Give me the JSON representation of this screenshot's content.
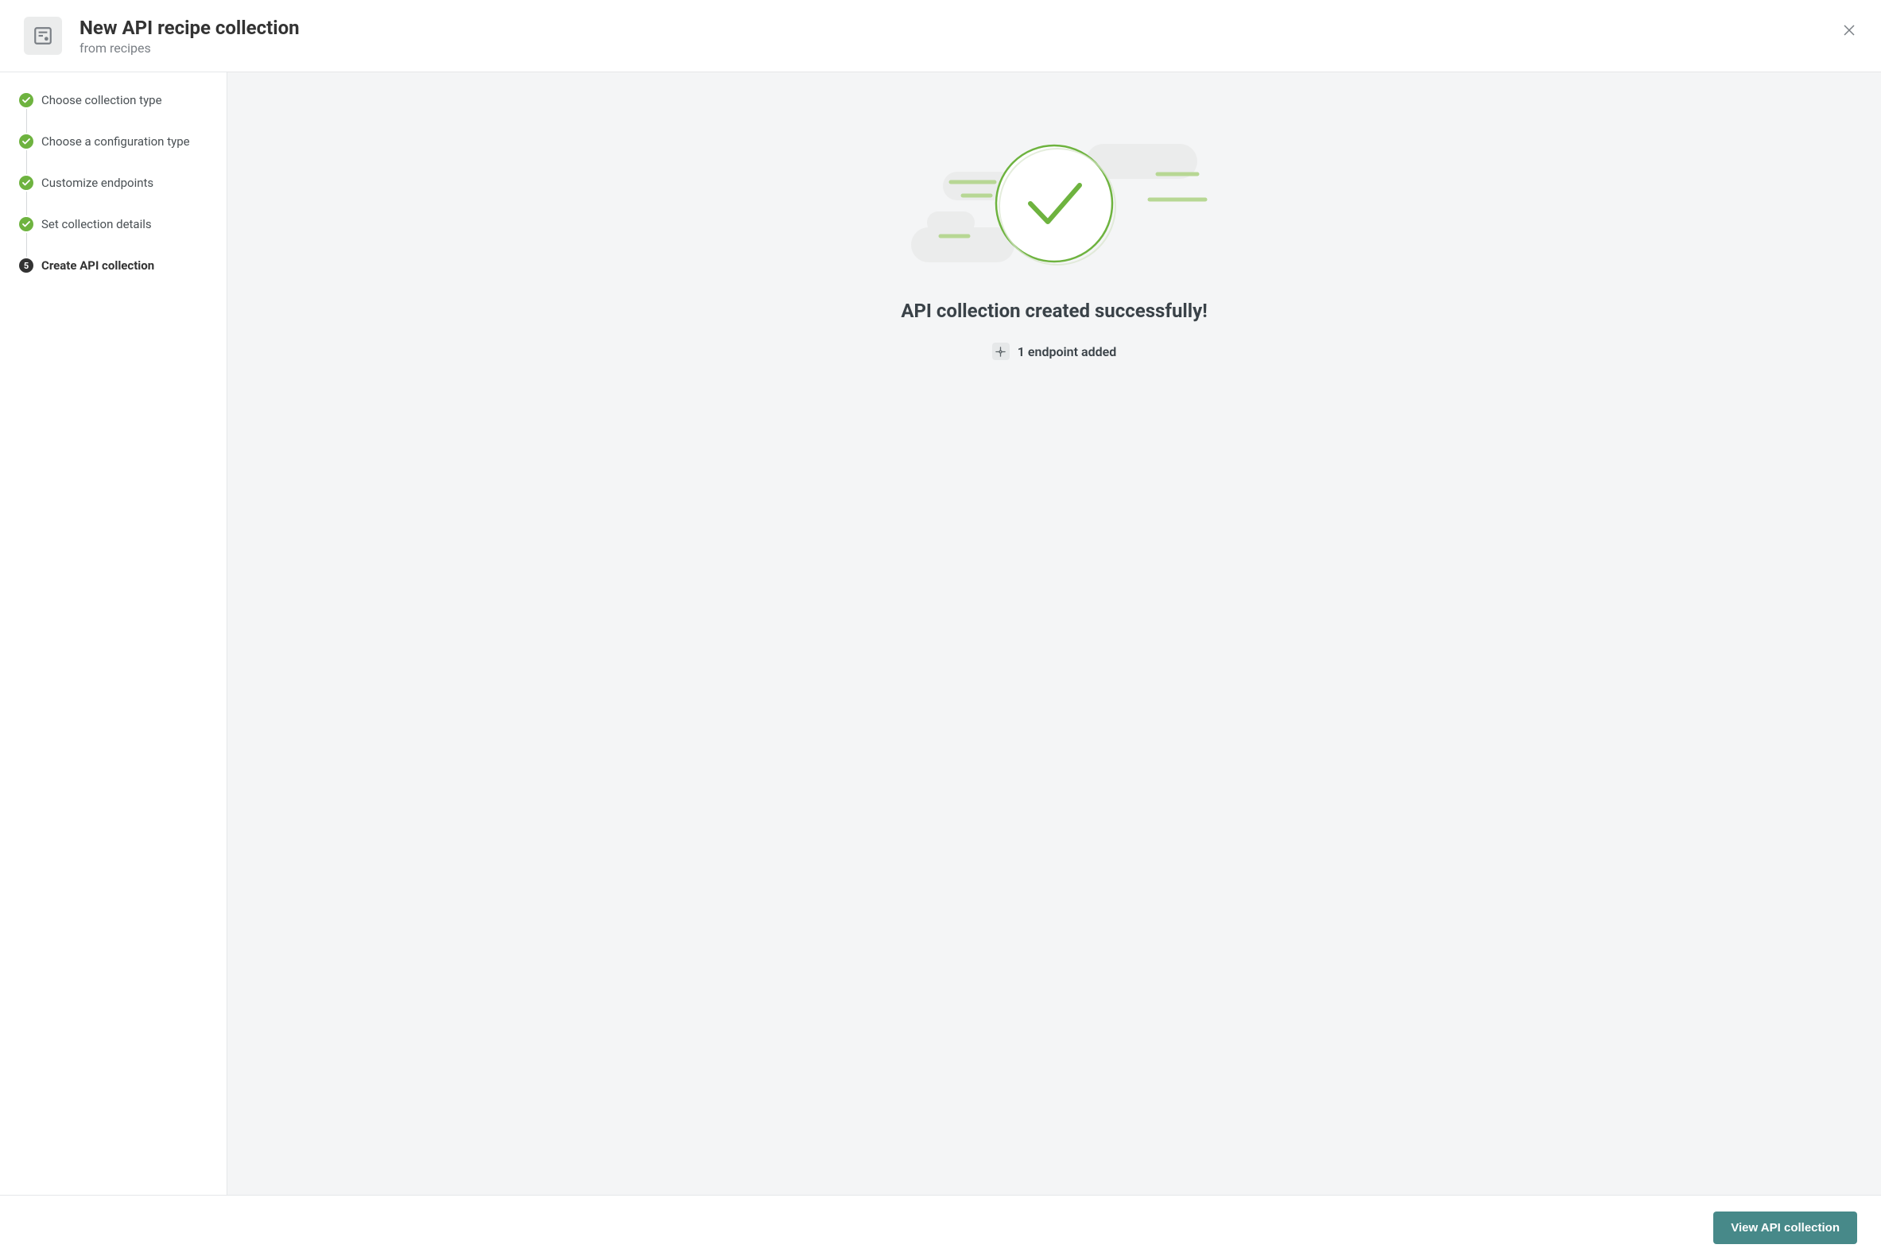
{
  "header": {
    "title": "New API recipe collection",
    "subtitle": "from recipes"
  },
  "steps": [
    {
      "label": "Choose collection type",
      "state": "done"
    },
    {
      "label": "Choose a configuration type",
      "state": "done"
    },
    {
      "label": "Customize endpoints",
      "state": "done"
    },
    {
      "label": "Set collection details",
      "state": "done"
    },
    {
      "label": "Create API collection",
      "state": "current",
      "number": "5"
    }
  ],
  "main": {
    "success_title": "API collection created successfully!",
    "endpoint_text": "1 endpoint added"
  },
  "footer": {
    "primary_button": "View API collection"
  },
  "colors": {
    "green": "#6eb33f",
    "teal": "#478989"
  }
}
